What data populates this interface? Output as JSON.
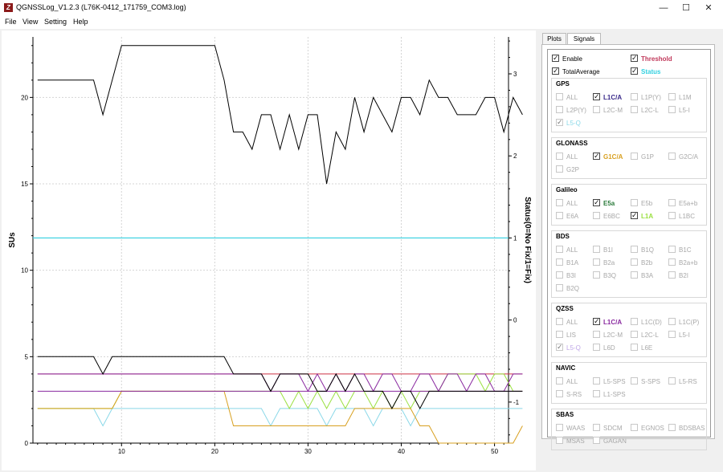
{
  "window": {
    "title": "QGNSSLog_V1.2.3 (L76K-0412_171759_COM3.log)",
    "icon_text": "Z",
    "minimize": "—",
    "maximize": "☐",
    "close": "✕"
  },
  "menu": [
    "File",
    "View",
    "Setting",
    "Help"
  ],
  "tabs": [
    "Plots",
    "Signals"
  ],
  "active_tab": "Signals",
  "top_options": [
    {
      "label": "Enable",
      "checked": true,
      "color": "#000000"
    },
    {
      "label": "Threshold",
      "checked": true,
      "color": "#c0385a"
    },
    {
      "label": "TotalAverage",
      "checked": true,
      "color": "#000000"
    },
    {
      "label": "Status",
      "checked": true,
      "color": "#33d0e0"
    }
  ],
  "groups": [
    {
      "title": "GPS",
      "items": [
        {
          "label": "ALL",
          "checked": false,
          "enabled": false
        },
        {
          "label": "L1C/A",
          "checked": true,
          "enabled": true,
          "color": "#3a2a8a"
        },
        {
          "label": "L1P(Y)",
          "checked": false,
          "enabled": false
        },
        {
          "label": "L1M",
          "checked": false,
          "enabled": false
        },
        {
          "label": "L2P(Y)",
          "checked": false,
          "enabled": false
        },
        {
          "label": "L2C-M",
          "checked": false,
          "enabled": false
        },
        {
          "label": "L2C-L",
          "checked": false,
          "enabled": false
        },
        {
          "label": "L5-I",
          "checked": false,
          "enabled": false
        },
        {
          "label": "L5-Q",
          "checked": true,
          "enabled": false,
          "color": "#8ad8e8"
        }
      ]
    },
    {
      "title": "GLONASS",
      "items": [
        {
          "label": "ALL",
          "checked": false,
          "enabled": false
        },
        {
          "label": "G1C/A",
          "checked": true,
          "enabled": true,
          "color": "#d8a020"
        },
        {
          "label": "G1P",
          "checked": false,
          "enabled": false
        },
        {
          "label": "G2C/A",
          "checked": false,
          "enabled": false
        },
        {
          "label": "G2P",
          "checked": false,
          "enabled": false
        }
      ]
    },
    {
      "title": "Galileo",
      "items": [
        {
          "label": "ALL",
          "checked": false,
          "enabled": false
        },
        {
          "label": "E5a",
          "checked": true,
          "enabled": true,
          "color": "#2a7a3a"
        },
        {
          "label": "E5b",
          "checked": false,
          "enabled": false
        },
        {
          "label": "E5a+b",
          "checked": false,
          "enabled": false
        },
        {
          "label": "E6A",
          "checked": false,
          "enabled": false
        },
        {
          "label": "E6BC",
          "checked": false,
          "enabled": false
        },
        {
          "label": "L1A",
          "checked": true,
          "enabled": true,
          "color": "#9ae040"
        },
        {
          "label": "L1BC",
          "checked": false,
          "enabled": false
        }
      ]
    },
    {
      "title": "BDS",
      "items": [
        {
          "label": "ALL",
          "checked": false,
          "enabled": false
        },
        {
          "label": "B1I",
          "checked": false,
          "enabled": false
        },
        {
          "label": "B1Q",
          "checked": false,
          "enabled": false
        },
        {
          "label": "B1C",
          "checked": false,
          "enabled": false
        },
        {
          "label": "B1A",
          "checked": false,
          "enabled": false
        },
        {
          "label": "B2a",
          "checked": false,
          "enabled": false
        },
        {
          "label": "B2b",
          "checked": false,
          "enabled": false
        },
        {
          "label": "B2a+b",
          "checked": false,
          "enabled": false
        },
        {
          "label": "B3I",
          "checked": false,
          "enabled": false
        },
        {
          "label": "B3Q",
          "checked": false,
          "enabled": false
        },
        {
          "label": "B3A",
          "checked": false,
          "enabled": false
        },
        {
          "label": "B2I",
          "checked": false,
          "enabled": false
        },
        {
          "label": "B2Q",
          "checked": false,
          "enabled": false
        }
      ]
    },
    {
      "title": "QZSS",
      "items": [
        {
          "label": "ALL",
          "checked": false,
          "enabled": false
        },
        {
          "label": "L1C/A",
          "checked": true,
          "enabled": true,
          "color": "#8a2aa0"
        },
        {
          "label": "L1C(D)",
          "checked": false,
          "enabled": false
        },
        {
          "label": "L1C(P)",
          "checked": false,
          "enabled": false
        },
        {
          "label": "LIS",
          "checked": false,
          "enabled": false
        },
        {
          "label": "L2C-M",
          "checked": false,
          "enabled": false
        },
        {
          "label": "L2C-L",
          "checked": false,
          "enabled": false
        },
        {
          "label": "L5-I",
          "checked": false,
          "enabled": false
        },
        {
          "label": "L5-Q",
          "checked": true,
          "enabled": false,
          "color": "#c0a8e8"
        },
        {
          "label": "L6D",
          "checked": false,
          "enabled": false
        },
        {
          "label": "L6E",
          "checked": false,
          "enabled": false
        }
      ]
    },
    {
      "title": "NAVIC",
      "items": [
        {
          "label": "ALL",
          "checked": false,
          "enabled": false
        },
        {
          "label": "L5-SPS",
          "checked": false,
          "enabled": false
        },
        {
          "label": "S-SPS",
          "checked": false,
          "enabled": false
        },
        {
          "label": "L5-RS",
          "checked": false,
          "enabled": false
        },
        {
          "label": "S-RS",
          "checked": false,
          "enabled": false
        },
        {
          "label": "L1-SPS",
          "checked": false,
          "enabled": false
        }
      ]
    },
    {
      "title": "SBAS",
      "items": [
        {
          "label": "WAAS",
          "checked": false,
          "enabled": false
        },
        {
          "label": "SDCM",
          "checked": false,
          "enabled": false
        },
        {
          "label": "EGNOS",
          "checked": false,
          "enabled": false
        },
        {
          "label": "BDSBAS",
          "checked": false,
          "enabled": false
        },
        {
          "label": "MSAS",
          "checked": false,
          "enabled": false
        },
        {
          "label": "GAGAN",
          "checked": false,
          "enabled": false
        }
      ]
    }
  ],
  "chart_data": {
    "type": "line",
    "ylabel": "SUs",
    "y2label": "Status(0=No Fix/1=Fix)",
    "xlim": [
      0.5,
      51.5
    ],
    "ylim": [
      0,
      23.5
    ],
    "y2lim": [
      -1.5,
      3.45
    ],
    "x_ticks": [
      10,
      20,
      30,
      40,
      50
    ],
    "y_ticks": [
      0,
      5,
      10,
      15,
      20
    ],
    "y2_ticks": [
      -1,
      0,
      1,
      2,
      3
    ],
    "grid": true,
    "series": [
      {
        "color": "#000000",
        "values": [
          21,
          21,
          21,
          21,
          21,
          21,
          21,
          19,
          21,
          23,
          23,
          23,
          23,
          23,
          23,
          23,
          23,
          23,
          23,
          23,
          21,
          18,
          18,
          17,
          19,
          19,
          17,
          19,
          17,
          19,
          19,
          15,
          18,
          17,
          20,
          18,
          20,
          19,
          18,
          20,
          20,
          19,
          21,
          20,
          20,
          19,
          19,
          19,
          20,
          20,
          18,
          20,
          19
        ]
      },
      {
        "color": "#000000",
        "values": [
          5,
          5,
          5,
          5,
          5,
          5,
          5,
          4,
          5,
          5,
          5,
          5,
          5,
          5,
          5,
          5,
          5,
          5,
          5,
          5,
          5,
          4,
          4,
          4,
          4,
          3,
          4,
          4,
          4,
          4,
          3,
          3,
          4,
          3,
          4,
          3,
          3,
          3,
          2,
          3,
          3,
          2,
          3,
          3,
          3,
          3,
          3,
          3,
          3,
          3,
          3,
          3,
          3
        ]
      },
      {
        "color": "#8a2aa0",
        "values": [
          4,
          4,
          4,
          4,
          4,
          4,
          4,
          4,
          4,
          4,
          4,
          4,
          4,
          4,
          4,
          4,
          4,
          4,
          4,
          4,
          4,
          4,
          4,
          4,
          4,
          3,
          4,
          4,
          4,
          3,
          4,
          3,
          4,
          3,
          4,
          4,
          3,
          4,
          4,
          3,
          3,
          4,
          4,
          3,
          4,
          4,
          3,
          4,
          4,
          3,
          3,
          4,
          4
        ]
      },
      {
        "color": "#8a2aa0",
        "values": [
          3,
          3,
          3,
          3,
          3,
          3,
          3,
          3,
          3,
          3,
          3,
          3,
          3,
          3,
          3,
          3,
          3,
          3,
          3,
          3,
          3,
          3,
          3,
          3,
          3,
          3,
          3,
          3,
          3,
          3,
          3,
          3,
          3,
          3,
          3,
          3,
          3,
          3,
          3,
          3,
          3,
          3,
          3,
          3,
          3,
          3,
          3,
          3,
          3,
          3,
          3,
          3,
          3
        ]
      },
      {
        "color": "#d8a020",
        "values": [
          2,
          2,
          2,
          2,
          2,
          2,
          2,
          2,
          2,
          3,
          3,
          3,
          3,
          3,
          3,
          3,
          3,
          3,
          3,
          3,
          3,
          1,
          1,
          1,
          1,
          1,
          1,
          1,
          1,
          1,
          1,
          1,
          1,
          1,
          2,
          2,
          2,
          2,
          2,
          2,
          2,
          1,
          1,
          0,
          0,
          0,
          0,
          0,
          0,
          0,
          0,
          0,
          1
        ]
      },
      {
        "color": "#9ae040",
        "values": [
          2,
          2,
          2,
          2,
          2,
          2,
          2,
          2,
          2,
          3,
          3,
          3,
          3,
          3,
          3,
          3,
          3,
          3,
          3,
          3,
          3,
          3,
          3,
          3,
          3,
          3,
          3,
          2,
          3,
          2,
          3,
          2,
          3,
          2,
          3,
          3,
          2,
          3,
          2,
          3,
          2,
          3,
          3,
          3,
          4,
          4,
          4,
          4,
          3,
          4,
          4,
          3,
          3
        ]
      },
      {
        "color": "#8ad8e8",
        "values": [
          2,
          2,
          2,
          2,
          2,
          2,
          2,
          1,
          2,
          2,
          2,
          2,
          2,
          2,
          2,
          2,
          2,
          2,
          2,
          2,
          2,
          2,
          2,
          2,
          2,
          1,
          2,
          2,
          2,
          2,
          2,
          1,
          2,
          2,
          2,
          2,
          1,
          2,
          2,
          2,
          1,
          2,
          2,
          2,
          2,
          2,
          2,
          2,
          2,
          2,
          2,
          2,
          2
        ]
      },
      {
        "color": "#cc3344",
        "values": [
          4,
          4,
          4,
          4,
          4,
          4,
          4,
          4,
          4,
          4,
          4,
          4,
          4,
          4,
          4,
          4,
          4,
          4,
          4,
          4,
          4,
          4,
          4,
          4,
          4,
          4,
          4,
          4,
          4,
          4,
          4,
          4,
          4,
          4,
          4,
          4,
          4,
          4,
          4,
          4,
          4,
          4,
          4,
          4,
          4,
          4,
          4,
          4,
          4,
          4,
          4,
          4,
          4
        ]
      }
    ],
    "status_series": {
      "color": "#33d0e0",
      "value": 1
    }
  }
}
